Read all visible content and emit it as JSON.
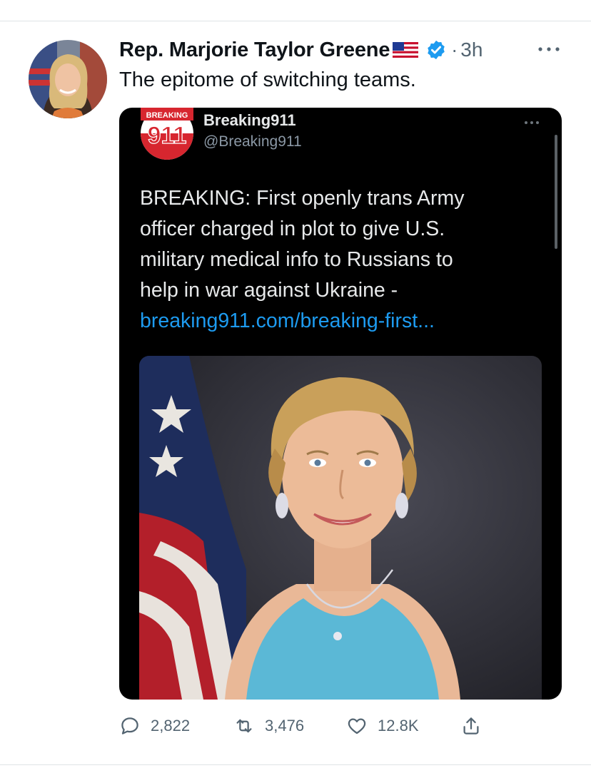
{
  "tweet": {
    "author_name": "Rep. Marjorie Taylor Greene",
    "flag_emoji": "us-flag-icon",
    "verified": true,
    "dot": "·",
    "time": "3h",
    "text": "The epitome of switching teams."
  },
  "quote": {
    "avatar_text": "BREAKING",
    "avatar_number": "911",
    "name": "Breaking911",
    "handle": "@Breaking911",
    "body_lines": [
      "BREAKING: First openly trans Army",
      "officer charged in plot to give U.S.",
      "military medical info to Russians to",
      "help in war against Ukraine -"
    ],
    "link": "breaking911.com/breaking-first..."
  },
  "actions": {
    "replies": "2,822",
    "retweets": "3,476",
    "likes": "12.8K"
  },
  "colors": {
    "link": "#1d9bf0",
    "verified": "#1d9bf0",
    "secondary_text": "#536471",
    "card_bg": "#000000",
    "brand_red": "#d7262f"
  }
}
